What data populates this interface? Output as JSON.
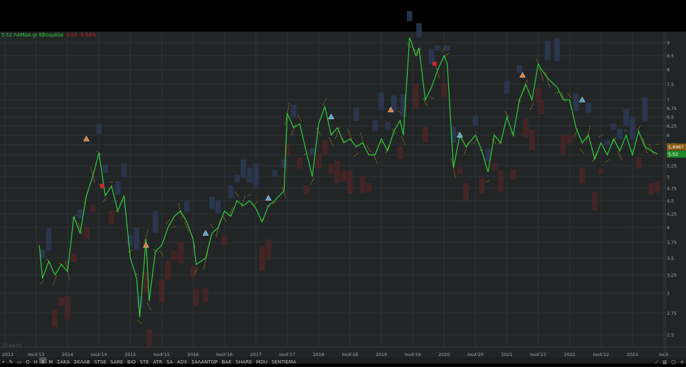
{
  "header": {
    "price": "5.52",
    "symbol": "ΛΑΜΔΑ.gr",
    "period": "Εβδομάδα",
    "change": "-0.03",
    "change_pct": "-0.54%"
  },
  "brand": "ΞTRADE",
  "toolbar": {
    "items": [
      "•",
      "✎",
      "▭",
      "O",
      "H",
      "E",
      "M",
      "ΣΑΚΑ",
      "ΣΚΛΑΒ",
      "STSE",
      "SARE",
      "BIO",
      "STE",
      "ATR",
      "SA",
      "ADX",
      "ΣΑΛΑΝΤΟΡ",
      "ΒΑΚ",
      "SHARE",
      "MOU",
      "SENTIEMA"
    ],
    "selected": "E",
    "right": [
      "⟋",
      "▥",
      "▢",
      "+"
    ]
  },
  "colors": {
    "line": "#2fd43c",
    "up_box": "#2c3a55",
    "down_box": "#4a2626",
    "grid": "#303436",
    "bg": "#222526",
    "tag_last": "#1e8a2a",
    "tag_ref": "#8a5a18"
  },
  "chart_data": {
    "type": "line",
    "title": "5.52 ΛΑΜΔΑ.gr Εβδομάδα",
    "yscale": "log",
    "ylim": [
      2.5,
      9.2
    ],
    "xlim": [
      2013.0,
      2023.62
    ],
    "yticks": [
      "9",
      "8,5",
      "8",
      "7,5",
      "7",
      "6,75",
      "6,5",
      "6,25",
      "6",
      "5,75",
      "5,5",
      "5,25",
      "5",
      "4,75",
      "4,5",
      "4,25",
      "4",
      "3,75",
      "3,5",
      "3,25",
      "3",
      "2,75",
      "2,5"
    ],
    "ytick_values": [
      9,
      8.5,
      8,
      7.5,
      7,
      6.75,
      6.5,
      6.25,
      6,
      5.75,
      5.5,
      5.25,
      5,
      4.75,
      4.5,
      4.25,
      4,
      3.75,
      3.5,
      3.25,
      3,
      2.75,
      2.5
    ],
    "xticks": [
      "2013",
      "Ιουλ'13",
      "2014",
      "Ιουλ'14",
      "2015",
      "Ιουλ'15",
      "2016",
      "Ιουλ'16",
      "2017",
      "Ιουλ'17",
      "2018",
      "Ιουλ'18",
      "2019",
      "Ιουλ'19",
      "2020",
      "Ιουλ'20",
      "2021",
      "Ιουλ'21",
      "2022",
      "Ιουλ'22",
      "2023",
      "Ιουλ"
    ],
    "xtick_values": [
      2013,
      2013.5,
      2014,
      2014.5,
      2015,
      2015.5,
      2016,
      2016.5,
      2017,
      2017.5,
      2018,
      2018.5,
      2019,
      2019.5,
      2020,
      2020.5,
      2021,
      2021.5,
      2022,
      2022.5,
      2023,
      2023.5
    ],
    "series": [
      {
        "name": "ΛΑΜΔΑ.gr",
        "x": [
          2013.55,
          2013.6,
          2013.7,
          2013.8,
          2013.9,
          2014.0,
          2014.1,
          2014.2,
          2014.3,
          2014.4,
          2014.5,
          2014.6,
          2014.7,
          2014.8,
          2014.9,
          2015.0,
          2015.1,
          2015.15,
          2015.25,
          2015.3,
          2015.4,
          2015.5,
          2015.6,
          2015.7,
          2015.8,
          2015.9,
          2016.0,
          2016.05,
          2016.2,
          2016.3,
          2016.4,
          2016.5,
          2016.6,
          2016.7,
          2016.8,
          2016.9,
          2017.0,
          2017.1,
          2017.2,
          2017.3,
          2017.45,
          2017.5,
          2017.6,
          2017.7,
          2017.8,
          2017.9,
          2018.0,
          2018.1,
          2018.2,
          2018.3,
          2018.4,
          2018.5,
          2018.6,
          2018.7,
          2018.8,
          2018.9,
          2019.0,
          2019.1,
          2019.2,
          2019.3,
          2019.35,
          2019.45,
          2019.55,
          2019.6,
          2019.7,
          2019.8,
          2019.9,
          2020.0,
          2020.05,
          2020.15,
          2020.25,
          2020.35,
          2020.5,
          2020.6,
          2020.7,
          2020.8,
          2020.9,
          2021.0,
          2021.1,
          2021.2,
          2021.3,
          2021.4,
          2021.5,
          2021.55,
          2021.65,
          2021.8,
          2021.9,
          2022.0,
          2022.1,
          2022.2,
          2022.3,
          2022.4,
          2022.5,
          2022.6,
          2022.7,
          2022.8,
          2022.9,
          2023.0,
          2023.1,
          2023.2,
          2023.3,
          2023.4
        ],
        "values": [
          3.7,
          3.2,
          3.45,
          3.25,
          3.4,
          3.3,
          4.2,
          3.9,
          4.6,
          5.0,
          5.55,
          4.6,
          4.8,
          4.3,
          4.6,
          3.5,
          3.2,
          2.7,
          3.8,
          2.9,
          3.6,
          3.7,
          4.0,
          4.2,
          4.3,
          4.1,
          3.8,
          3.4,
          3.5,
          3.9,
          4.0,
          4.3,
          4.2,
          4.5,
          4.4,
          4.5,
          4.35,
          4.1,
          4.4,
          4.5,
          4.7,
          6.6,
          6.2,
          6.3,
          5.6,
          5.0,
          6.3,
          6.8,
          6.0,
          6.2,
          5.8,
          5.9,
          5.7,
          5.8,
          5.5,
          5.5,
          5.9,
          5.6,
          6.1,
          6.4,
          6.0,
          9.2,
          8.5,
          8.8,
          7.0,
          7.4,
          8.0,
          8.5,
          8.2,
          5.2,
          6.0,
          5.7,
          6.0,
          5.6,
          5.1,
          6.0,
          5.8,
          6.5,
          6.0,
          7.0,
          7.5,
          7.0,
          8.2,
          8.0,
          7.7,
          7.4,
          7.0,
          7.0,
          6.2,
          5.8,
          6.0,
          5.4,
          5.8,
          5.5,
          5.9,
          5.6,
          6.0,
          5.5,
          6.1,
          5.7,
          5.6,
          5.52
        ]
      }
    ],
    "price_tags": [
      {
        "label": "5,6967",
        "value": 5.6967,
        "kind": "reference"
      },
      {
        "label": "5,52",
        "value": 5.52,
        "kind": "last"
      }
    ],
    "markers": [
      {
        "x": 2014.3,
        "value": 5.9,
        "kind": "warning"
      },
      {
        "x": 2014.55,
        "value": 4.8,
        "kind": "sell"
      },
      {
        "x": 2015.25,
        "value": 3.7,
        "kind": "warning"
      },
      {
        "x": 2016.2,
        "value": 3.9,
        "kind": "info"
      },
      {
        "x": 2017.2,
        "value": 4.55,
        "kind": "info"
      },
      {
        "x": 2018.2,
        "value": 6.5,
        "kind": "info"
      },
      {
        "x": 2019.15,
        "value": 6.7,
        "kind": "warning"
      },
      {
        "x": 2019.85,
        "value": 8.2,
        "kind": "sell"
      },
      {
        "x": 2020.25,
        "value": 6.0,
        "kind": "info"
      },
      {
        "x": 2021.25,
        "value": 7.8,
        "kind": "warning"
      },
      {
        "x": 2022.2,
        "value": 7.0,
        "kind": "info"
      }
    ]
  }
}
